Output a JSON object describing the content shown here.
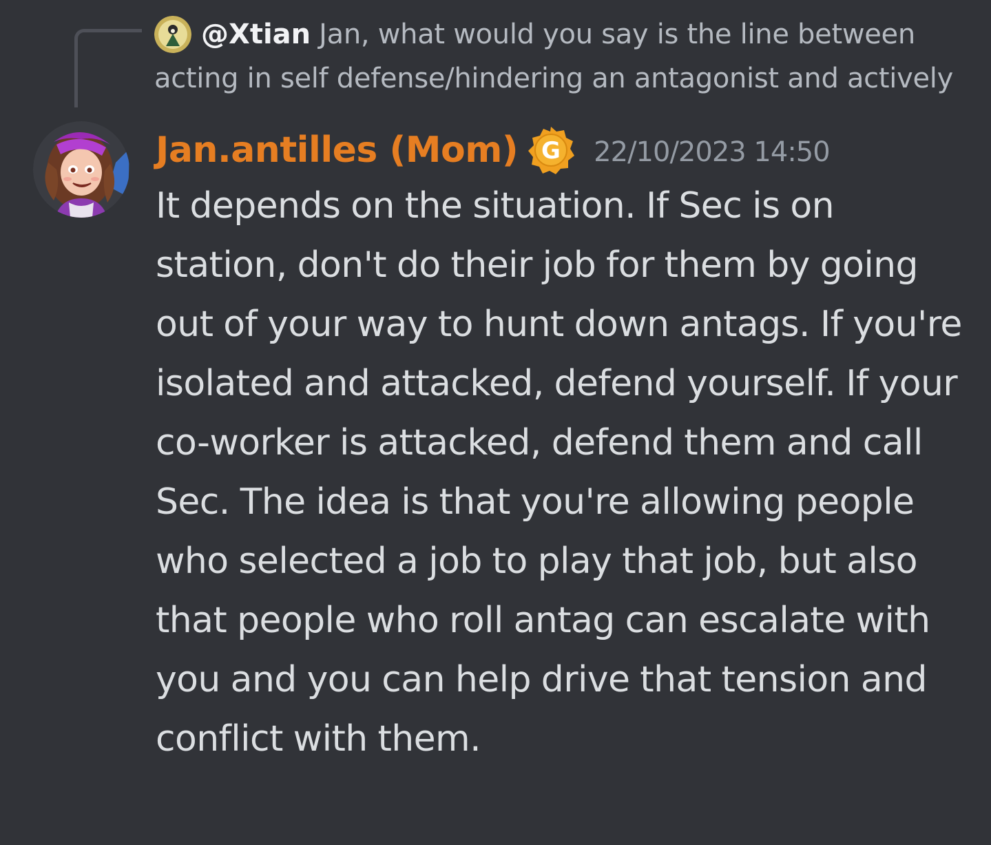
{
  "reply": {
    "author": "@Xtian",
    "text": "Jan, what would you say is the line between acting in self defense/hindering an antagonist and actively"
  },
  "message": {
    "author": "Jan.antilles (Mom)",
    "badge_letter": "G",
    "timestamp": "22/10/2023 14:50",
    "content": "It depends on the situation. If Sec is on station, don't do their job for them by going out of your way to hunt down antags. If you're isolated and attacked, defend yourself. If your co-worker is attacked, defend them and call Sec. The idea is that you're allowing people who selected a job to play that job, but also that people who roll antag can escalate with you and you can help drive that tension and conflict with them."
  },
  "colors": {
    "background": "#313338",
    "author_color": "#e67e22",
    "badge_color": "#f0a020",
    "text": "#dbdee1",
    "muted": "#b5bac1"
  },
  "icons": {
    "reply_avatar": "user-avatar-icon",
    "author_avatar": "user-avatar-icon",
    "role_badge": "guild-badge-icon"
  }
}
